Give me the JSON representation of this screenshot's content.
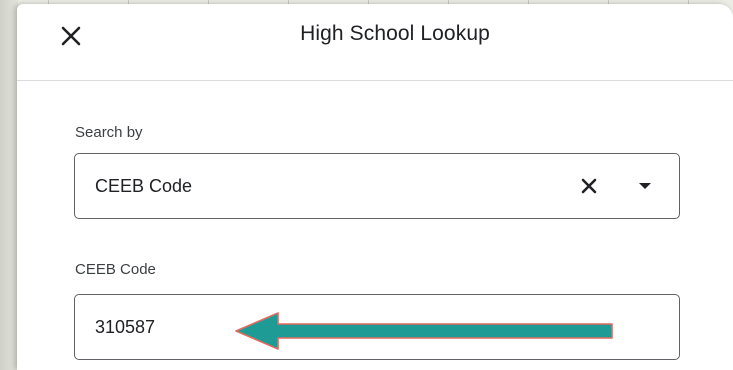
{
  "dialog": {
    "title": "High School Lookup",
    "close_icon": "close-icon"
  },
  "search_by": {
    "label": "Search by",
    "selected_value": "CEEB Code",
    "clear_icon": "clear-icon",
    "dropdown_icon": "chevron-down-icon"
  },
  "ceeb_code": {
    "label": "CEEB Code",
    "value": "310587"
  },
  "annotation": {
    "type": "arrow-pointing-left",
    "fill_color": "#1f9b95",
    "stroke_color": "#e06b60"
  }
}
